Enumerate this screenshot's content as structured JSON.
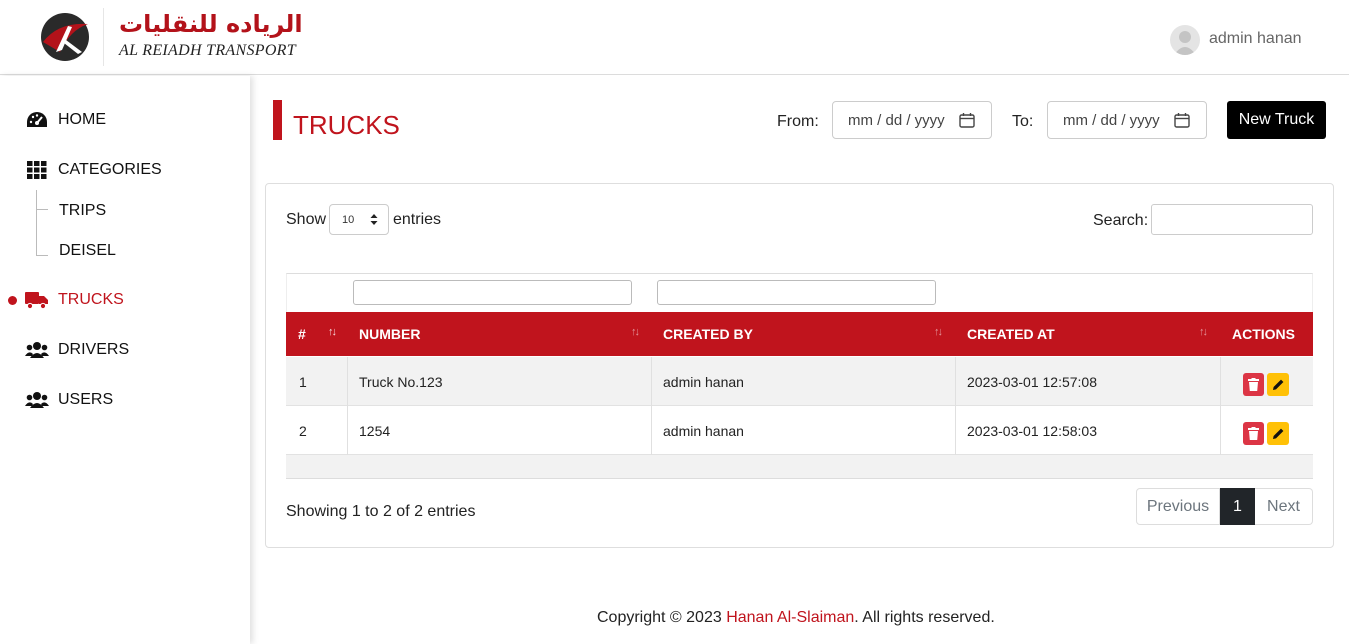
{
  "brand": {
    "arabic_name": "الرياده للنقليات",
    "english_name": "AL REIADH TRANSPORT"
  },
  "user": {
    "name": "admin hanan"
  },
  "sidebar": {
    "items": [
      {
        "label": "HOME",
        "icon": "dashboard-gauge-icon"
      },
      {
        "label": "CATEGORIES",
        "icon": "grid-icon"
      },
      {
        "label": "TRUCKS",
        "icon": "truck-icon",
        "active": true
      },
      {
        "label": "DRIVERS",
        "icon": "users-group-icon"
      },
      {
        "label": "USERS",
        "icon": "users-group-icon"
      }
    ],
    "sub_items": [
      {
        "label": "TRIPS"
      },
      {
        "label": "DEISEL"
      }
    ]
  },
  "page": {
    "title": "TRUCKS",
    "from_label": "From:",
    "to_label": "To:",
    "date_placeholder": "mm / dd / yyyy",
    "new_button": "New Truck"
  },
  "table_controls": {
    "show_label": "Show",
    "page_length": "10",
    "entries_label": "entries",
    "search_label": "Search:"
  },
  "table": {
    "columns": [
      "#",
      "NUMBER",
      "CREATED BY",
      "CREATED AT",
      "ACTIONS"
    ],
    "rows": [
      {
        "index": "1",
        "number": "Truck No.123",
        "created_by": "admin hanan",
        "created_at": "2023-03-01 12:57:08"
      },
      {
        "index": "2",
        "number": "1254",
        "created_by": "admin hanan",
        "created_at": "2023-03-01 12:58:03"
      }
    ],
    "info": "Showing 1 to 2 of 2 entries"
  },
  "pagination": {
    "previous": "Previous",
    "current": "1",
    "next": "Next"
  },
  "footer": {
    "prefix": "Copyright © 2023",
    "author": "Hanan Al-Slaiman",
    "suffix": ". All rights reserved."
  },
  "colors": {
    "brand_red": "#c0141d",
    "delete_red": "#dc3545",
    "edit_yellow": "#ffc107",
    "button_black": "#000000"
  }
}
